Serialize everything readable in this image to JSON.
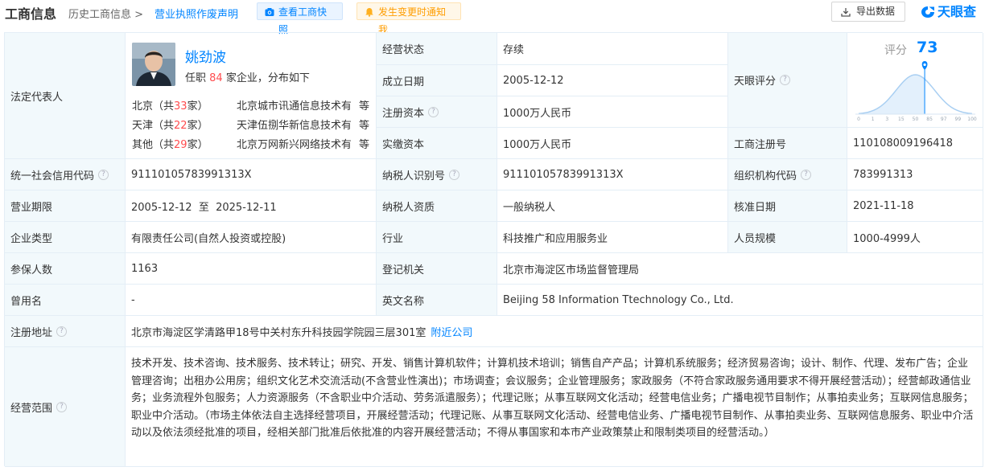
{
  "header": {
    "title": "工商信息",
    "history": "历史工商信息 >",
    "statement": "营业执照作废声明",
    "snapshot_btn": "查看工商快照",
    "notify_btn": "发生变更时通知我",
    "export_btn": "导出数据",
    "logo": "天眼查"
  },
  "legal_rep": {
    "label": "法定代表人",
    "name": "姚劲波",
    "desc_prefix": "任职",
    "count": "84",
    "desc_suffix": "家企业，分布如下",
    "regions": [
      {
        "city_prefix": "北京（共",
        "count": "33",
        "city_suffix": "家）",
        "company": "北京城市讯通信息技术有限公司",
        "etc": "等"
      },
      {
        "city_prefix": "天津（共",
        "count": "22",
        "city_suffix": "家）",
        "company": "天津伍捌华新信息技术有限公司",
        "etc": "等"
      },
      {
        "city_prefix": "其他（共",
        "count": "29",
        "city_suffix": "家）",
        "company": "北京万网新兴网络技术有限公司",
        "etc": "等"
      }
    ]
  },
  "fields": {
    "status_label": "经营状态",
    "status": "存续",
    "founded_label": "成立日期",
    "founded": "2005-12-12",
    "reg_capital_label": "注册资本",
    "reg_capital": "1000万人民币",
    "paid_capital_label": "实缴资本",
    "paid_capital": "1000万人民币",
    "score_label": "天眼评分",
    "reg_no_label": "工商注册号",
    "reg_no": "110108009196418",
    "credit_code_label": "统一社会信用代码",
    "credit_code": "91110105783991313X",
    "taxpayer_id_label": "纳税人识别号",
    "taxpayer_id": "91110105783991313X",
    "org_code_label": "组织机构代码",
    "org_code": "783991313",
    "term_label": "营业期限",
    "term": "2005-12-12  至  2025-12-11",
    "taxpayer_qual_label": "纳税人资质",
    "taxpayer_qual": "一般纳税人",
    "approved_label": "核准日期",
    "approved": "2021-11-18",
    "type_label": "企业类型",
    "type": "有限责任公司(自然人投资或控股)",
    "industry_label": "行业",
    "industry": "科技推广和应用服务业",
    "staff_label": "人员规模",
    "staff": "1000-4999人",
    "insured_label": "参保人数",
    "insured": "1163",
    "authority_label": "登记机关",
    "authority": "北京市海淀区市场监督管理局",
    "former_label": "曾用名",
    "former": "-",
    "english_label": "英文名称",
    "english": "Beijing 58 Information Ttechnology Co., Ltd.",
    "address_label": "注册地址",
    "address": "北京市海淀区学清路甲18号中关村东升科技园学院园三层301室",
    "nearby": "附近公司",
    "scope_label": "经营范围",
    "scope": "技术开发、技术咨询、技术服务、技术转让；研究、开发、销售计算机软件；计算机技术培训；销售自产产品；计算机系统服务；经济贸易咨询；设计、制作、代理、发布广告；企业管理咨询；出租办公用房；组织文化艺术交流活动(不含营业性演出)；市场调查；会议服务；企业管理服务；家政服务（不符合家政服务通用要求不得开展经营活动）；经营邮政通信业务；业务流程外包服务；人力资源服务（不含职业中介活动、劳务派遣服务）；代理记账；从事互联网文化活动；经营电信业务；广播电视节目制作；从事拍卖业务；互联网信息服务；职业中介活动。（市场主体依法自主选择经营项目，开展经营活动；代理记账、从事互联网文化活动、经营电信业务、广播电视节目制作、从事拍卖业务、互联网信息服务、职业中介活动以及依法须经批准的项目，经相关部门批准后依批准的内容开展经营活动；不得从事国家和本市产业政策禁止和限制类项目的经营活动。）"
  },
  "score": {
    "label": "评分",
    "value": 73,
    "ticks": [
      "0",
      "1",
      "3",
      "15",
      "50",
      "85",
      "97",
      "99",
      "100"
    ]
  },
  "colors": {
    "accent": "#0084ff",
    "label_bg": "#f2f9fc",
    "border": "#e4eef6",
    "highlight": "#ff4d4f"
  }
}
